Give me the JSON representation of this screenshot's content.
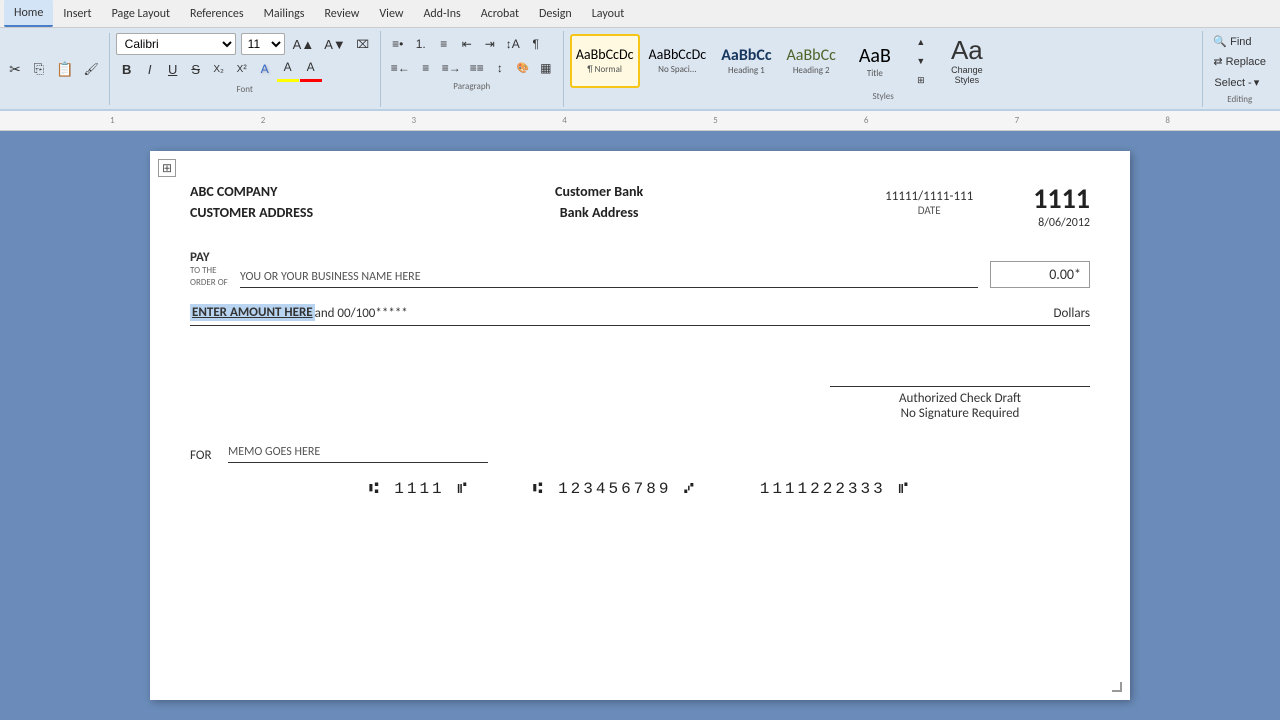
{
  "menubar": {
    "items": [
      "Home",
      "Insert",
      "Page Layout",
      "References",
      "Mailings",
      "Review",
      "View",
      "Add-Ins",
      "Acrobat",
      "Design",
      "Layout"
    ]
  },
  "ribbon": {
    "font_family": "Calibri",
    "font_size": "11",
    "styles": [
      {
        "label": "Normal",
        "preview": "AaBbCcDc",
        "active": true
      },
      {
        "label": "No Spaci...",
        "preview": "AaBbCcDc",
        "active": false
      },
      {
        "label": "Heading 1",
        "preview": "AaBbCc",
        "active": false
      },
      {
        "label": "Heading 2",
        "preview": "AaBbCc",
        "active": false
      },
      {
        "label": "Title",
        "preview": "AaB",
        "active": false
      }
    ],
    "change_styles_label": "Change\nStyles",
    "find_label": "Find",
    "replace_label": "Replace",
    "select_label": "Select -"
  },
  "check": {
    "company_name": "ABC COMPANY",
    "company_address": "CUSTOMER ADDRESS",
    "bank_name": "Customer Bank",
    "bank_address": "Bank Address",
    "routing_number": "11111/1111-111",
    "check_number": "1111",
    "date_label": "DATE",
    "date_value": "8/06/2012",
    "pay_label": "PAY",
    "pay_to_label": "TO THE\nORDER OF",
    "payee_placeholder": "YOU OR YOUR BUSINESS NAME HERE",
    "amount_box": "0.00*",
    "amount_text_highlighted": "ENTER AMOUNT HERE",
    "amount_text_and": " and 00/100*****",
    "dollars_label": "Dollars",
    "authorized_line1": "Authorized Check Draft",
    "authorized_line2": "No Signature Required",
    "for_label": "FOR",
    "memo_placeholder": "MEMO GOES HERE",
    "micr_line": "⑆1111⑈  ⑆ 123456789 ⑇  1111222333⑈",
    "micr_part1": "⑆ 1111 ⑈",
    "micr_part2": "⑆ 123456789 ⑇",
    "micr_part3": "1111222333 ⑈"
  }
}
